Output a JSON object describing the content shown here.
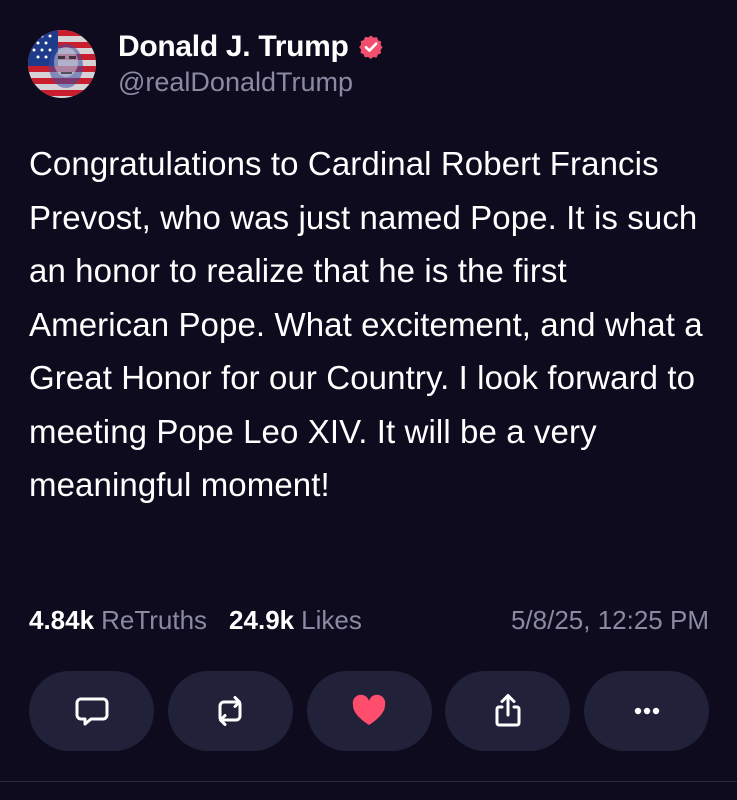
{
  "author": {
    "display_name": "Donald J. Trump",
    "handle": "@realDonaldTrump",
    "avatar_icon": "flag-portrait-avatar",
    "verified_icon": "verified-badge-icon",
    "verified_color": "#f0506e"
  },
  "post": {
    "text": "Congratulations to Cardinal Robert Francis Prevost, who was just named Pope. It is such an honor to realize that he is the first American Pope. What excitement, and what a Great Honor for our Country. I look forward to meeting Pope Leo XIV. It will be a very meaningful moment!"
  },
  "stats": {
    "retruths_count": "4.84k",
    "retruths_label": "ReTruths",
    "likes_count": "24.9k",
    "likes_label": "Likes",
    "timestamp": "5/8/25, 12:25 PM"
  },
  "actions": [
    {
      "name": "reply",
      "icon": "comment-icon"
    },
    {
      "name": "retruth",
      "icon": "repost-icon"
    },
    {
      "name": "like",
      "icon": "heart-icon",
      "color": "#ff4d6d"
    },
    {
      "name": "share",
      "icon": "share-icon"
    },
    {
      "name": "more",
      "icon": "more-icon"
    }
  ],
  "colors": {
    "background": "#0d0b1d",
    "button_bg": "#22213a",
    "muted_text": "#8b8aa3",
    "like_accent": "#ff4d6d"
  }
}
